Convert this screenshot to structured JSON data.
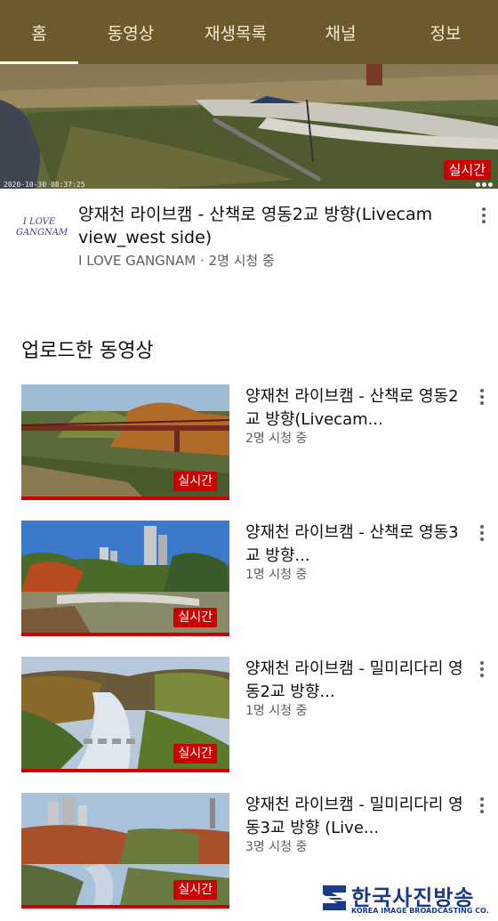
{
  "tabs": [
    {
      "label": "홈",
      "active": true
    },
    {
      "label": "동영상",
      "active": false
    },
    {
      "label": "재생목록",
      "active": false
    },
    {
      "label": "채널",
      "active": false
    },
    {
      "label": "정보",
      "active": false
    }
  ],
  "hero": {
    "live_badge": "실시간",
    "timestamp": "2020-10-30 08:37:25"
  },
  "channel": {
    "logo_line1": "I LOVE",
    "logo_line2": "GANGNAM",
    "title": "양재천 라이브캠 - 산책로 영동2교 방향(Livecam view_west side)",
    "meta": "I LOVE GANGNAM · 2명 시청 중"
  },
  "uploads": {
    "section_title": "업로드한 동영상",
    "videos": [
      {
        "title": "양재천 라이브캠 - 산책로 영동2교 방향(Livecam...",
        "meta": "2명 시청 중",
        "badge": "실시간"
      },
      {
        "title": "양재천 라이브캠 - 산책로 영동3교 방향...",
        "meta": "1명 시청 중",
        "badge": "실시간"
      },
      {
        "title": "양재천 라이브캠 - 밀미리다리 영동2교 방향...",
        "meta": "1명 시청 중",
        "badge": "실시간"
      },
      {
        "title": "양재천  라이브캠 - 밀미리다리 영동3교 방향 (Live...",
        "meta": "3명 시청 중",
        "badge": "실시간"
      }
    ]
  },
  "watermark": {
    "korean": "한국사진방송",
    "english": "KOREA IMAGE BROADCASTING CO."
  },
  "colors": {
    "tabbar": "#6b5a2c",
    "live_red": "#cc0000",
    "brand_blue": "#1a3a8a"
  }
}
